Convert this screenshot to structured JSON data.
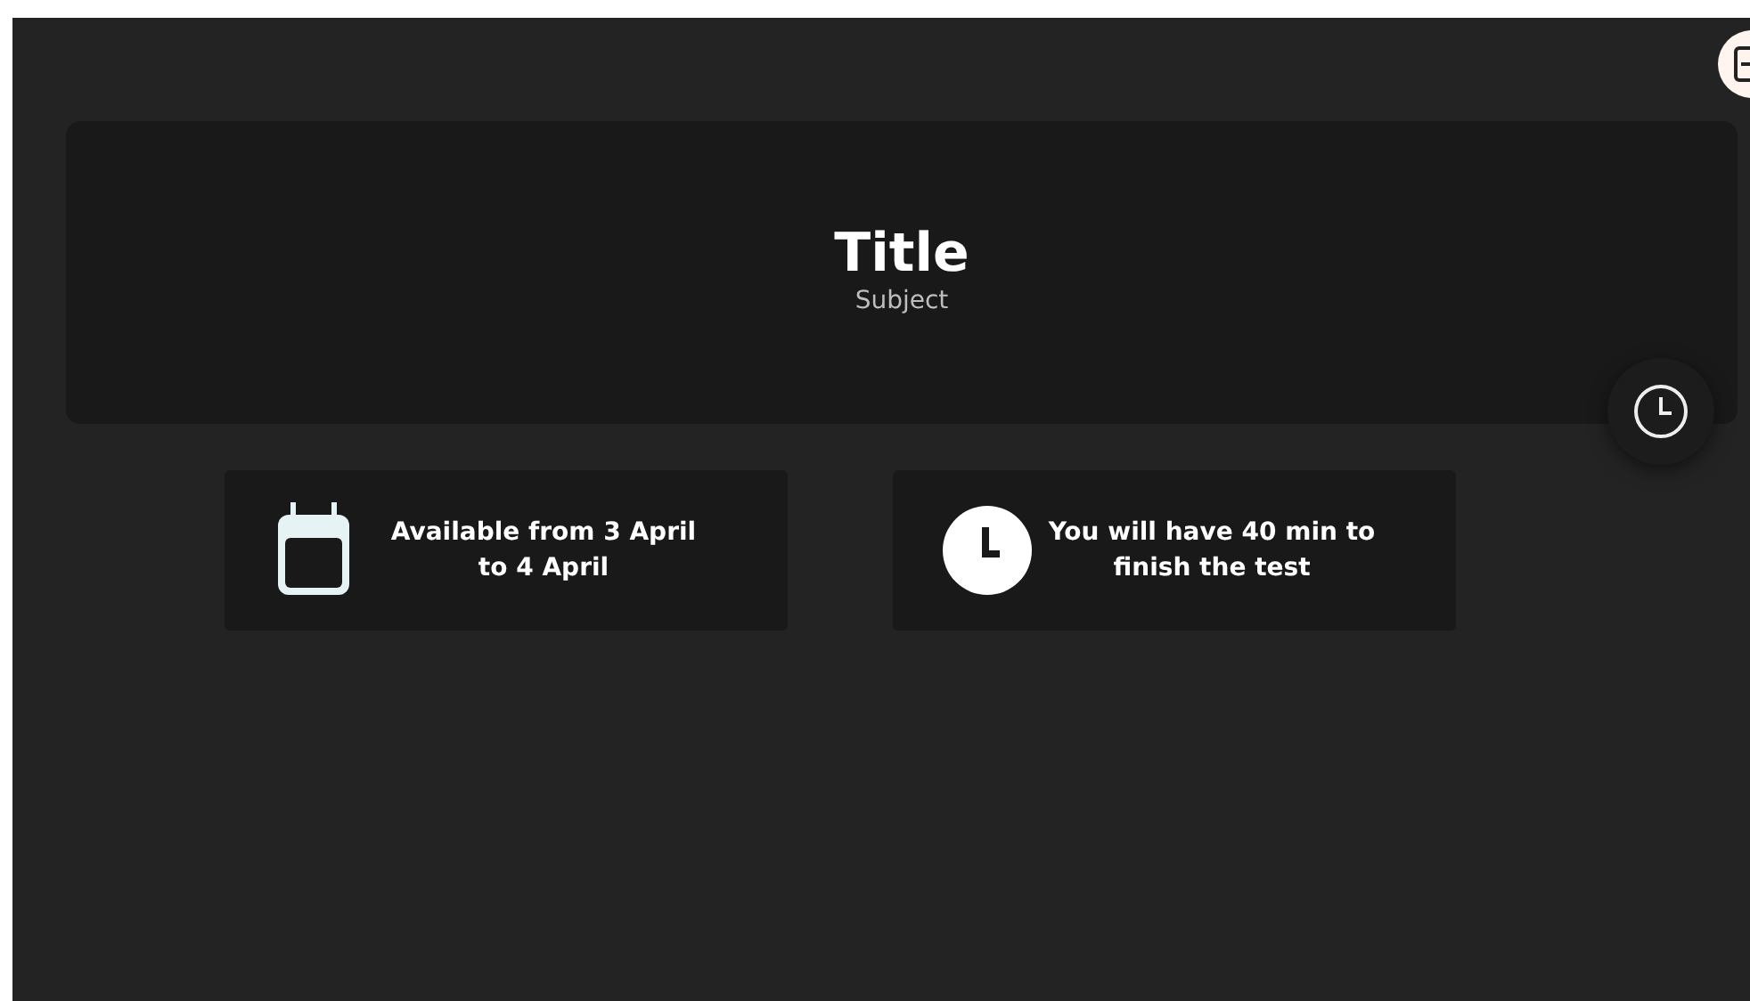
{
  "header": {
    "title": "Title",
    "subject": "Subject"
  },
  "info_cards": [
    {
      "kind": "calendar",
      "text": "Available from 3 April to 4 April"
    },
    {
      "kind": "clock",
      "text": "You will have 40 min to finish the test"
    }
  ]
}
